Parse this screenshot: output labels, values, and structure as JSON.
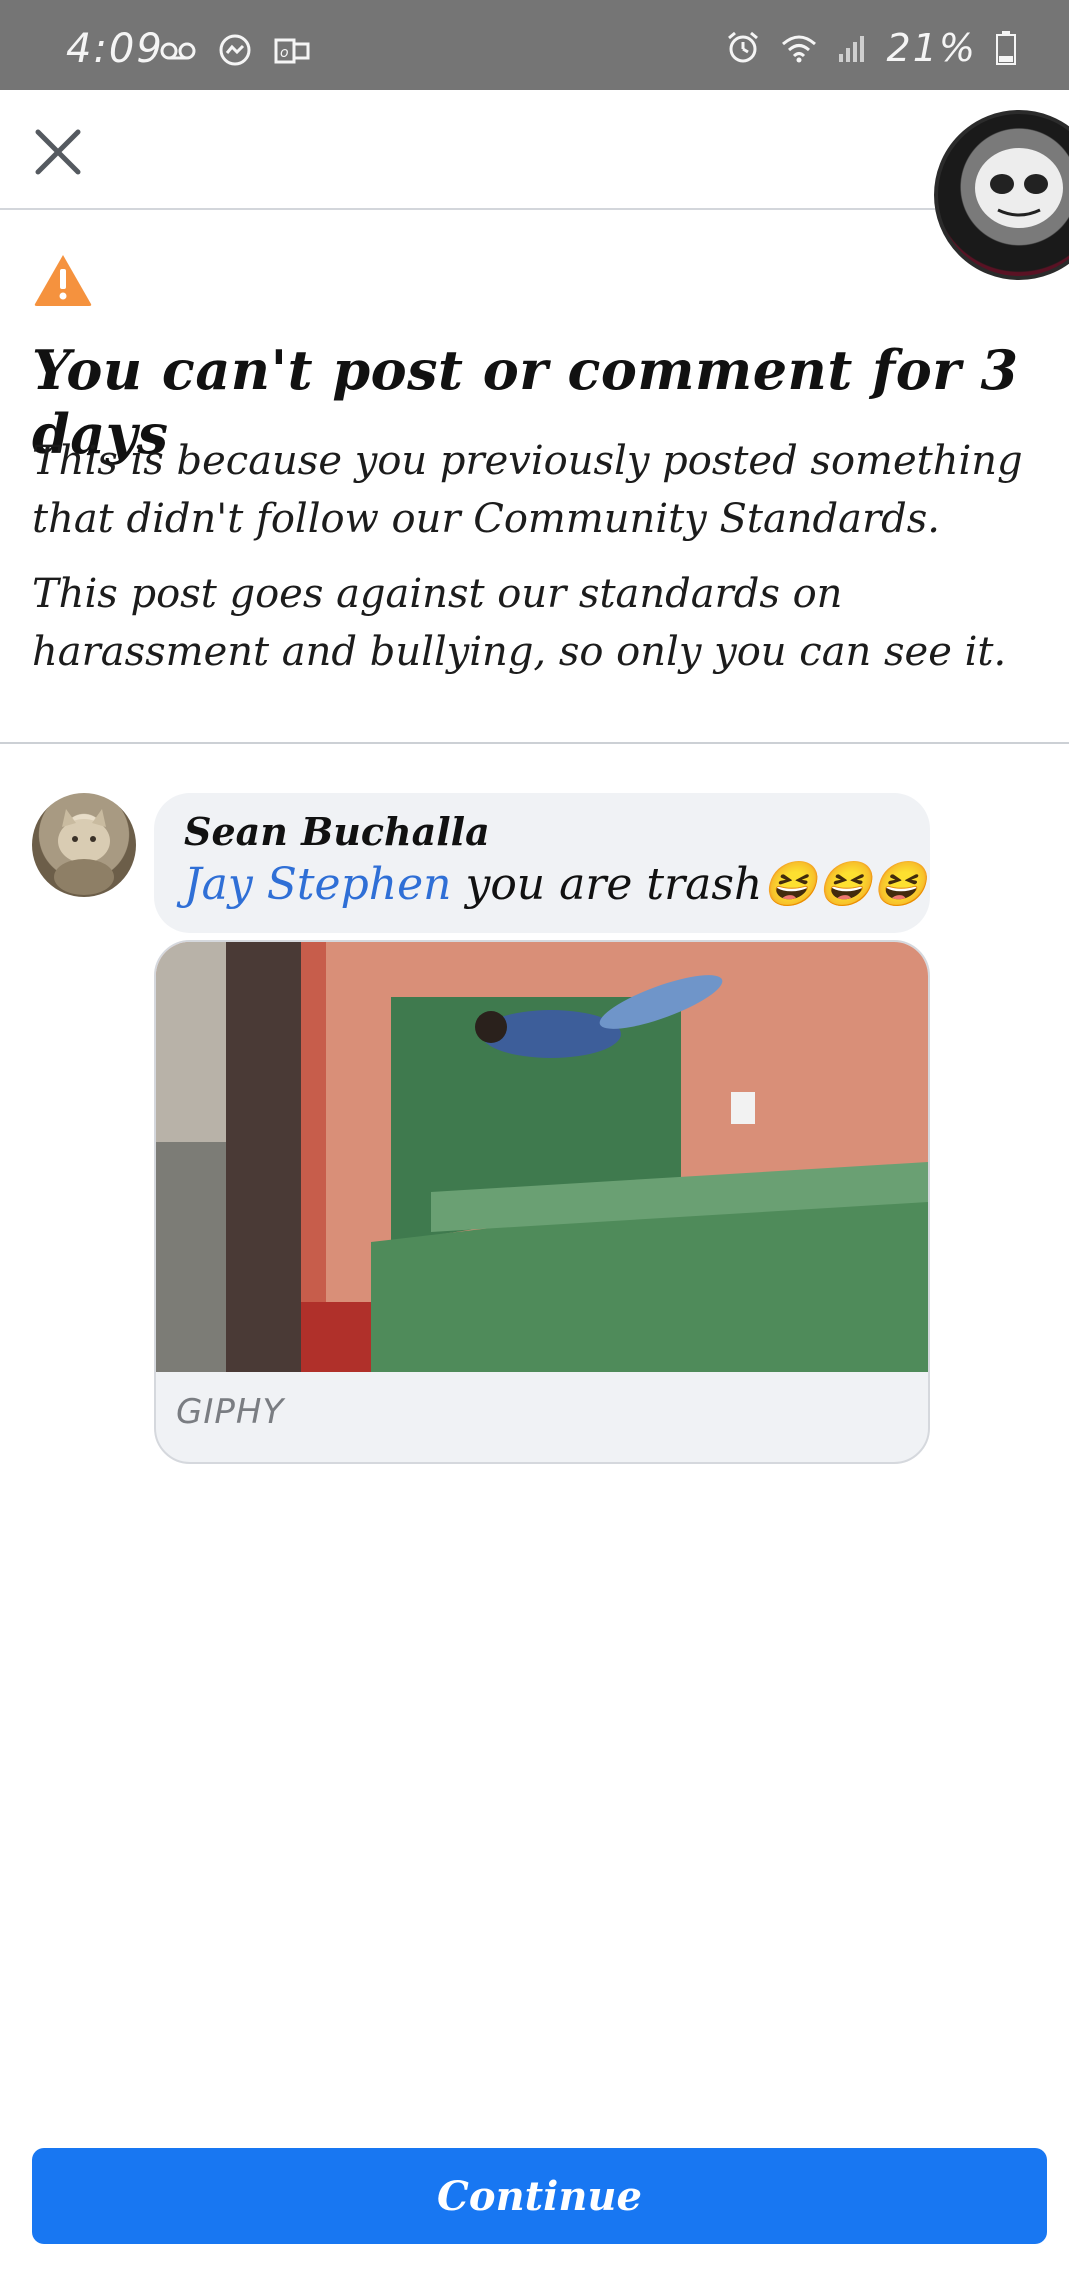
{
  "status_bar": {
    "time": "4:09",
    "battery_percent": "21%",
    "left_icons": [
      "voicemail-icon",
      "messenger-icon",
      "outlook-icon"
    ],
    "right_icons": [
      "alarm-icon",
      "wifi-icon",
      "signal-icon",
      "battery-icon"
    ]
  },
  "header": {
    "close_icon": "close-icon"
  },
  "notice": {
    "icon": "warning-icon",
    "icon_color": "#f5923e",
    "title": "You can't post or comment for 3 days",
    "paragraph_1": "This is because you previously posted something that didn't follow our Community Standards.",
    "paragraph_2": "This post goes against our standards on harassment and bullying, so only you can see it."
  },
  "comment": {
    "author": "Sean Buchalla",
    "mention": "Jay Stephen",
    "text": " you are trash😆😆😆",
    "mention_color": "#2f6fd6",
    "attachment": {
      "source_label": "GIPHY"
    }
  },
  "footer": {
    "continue_label": "Continue",
    "button_color": "#1877f2"
  }
}
